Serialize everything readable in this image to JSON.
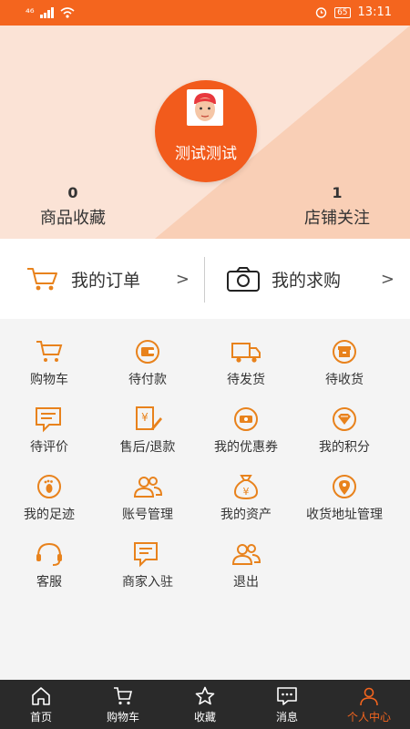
{
  "status_bar": {
    "network": "⁴⁶",
    "battery": "65",
    "time": "13:11"
  },
  "profile": {
    "username": "测试测试",
    "stats": [
      {
        "count": "0",
        "label": "商品收藏"
      },
      {
        "count": "1",
        "label": "店铺关注"
      }
    ]
  },
  "orders": {
    "my_orders": "我的订单",
    "my_requests": "我的求购",
    "arrow": ">"
  },
  "menu": [
    {
      "label": "购物车",
      "icon": "cart-icon"
    },
    {
      "label": "待付款",
      "icon": "wallet-icon"
    },
    {
      "label": "待发货",
      "icon": "truck-icon"
    },
    {
      "label": "待收货",
      "icon": "box-icon"
    },
    {
      "label": "待评价",
      "icon": "comment-icon"
    },
    {
      "label": "售后/退款",
      "icon": "refund-icon"
    },
    {
      "label": "我的优惠券",
      "icon": "coupon-icon"
    },
    {
      "label": "我的积分",
      "icon": "points-icon"
    },
    {
      "label": "我的足迹",
      "icon": "footprint-icon"
    },
    {
      "label": "账号管理",
      "icon": "account-icon"
    },
    {
      "label": "我的资产",
      "icon": "money-bag-icon"
    },
    {
      "label": "收货地址管理",
      "icon": "location-icon"
    },
    {
      "label": "客服",
      "icon": "headset-icon"
    },
    {
      "label": "商家入驻",
      "icon": "merchant-icon"
    },
    {
      "label": "退出",
      "icon": "logout-icon"
    }
  ],
  "tabs": [
    {
      "label": "首页",
      "icon": "home-icon"
    },
    {
      "label": "购物车",
      "icon": "cart-icon"
    },
    {
      "label": "收藏",
      "icon": "star-icon"
    },
    {
      "label": "消息",
      "icon": "message-icon"
    },
    {
      "label": "个人中心",
      "icon": "person-icon",
      "active": true
    }
  ],
  "colors": {
    "accent": "#f4651e",
    "icon": "#e8821c",
    "tabbar": "#2a2a2a"
  }
}
